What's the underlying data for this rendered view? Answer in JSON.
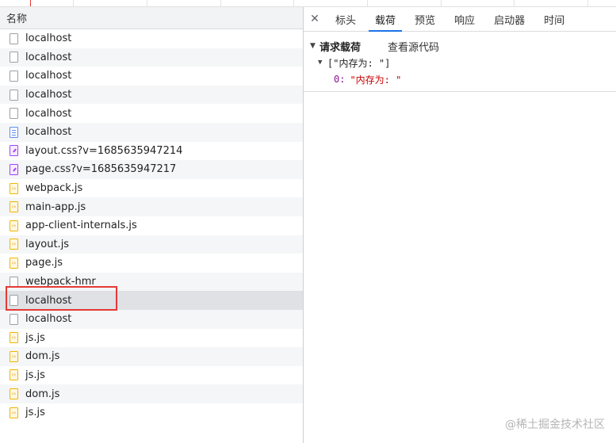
{
  "list": {
    "column_header": "名称",
    "rows": [
      {
        "name": "localhost",
        "icon": "document-icon"
      },
      {
        "name": "localhost",
        "icon": "document-icon"
      },
      {
        "name": "localhost",
        "icon": "document-icon"
      },
      {
        "name": "localhost",
        "icon": "document-icon"
      },
      {
        "name": "localhost",
        "icon": "document-icon"
      },
      {
        "name": "localhost",
        "icon": "html-document-icon"
      },
      {
        "name": "layout.css?v=1685635947214",
        "icon": "stylesheet-icon"
      },
      {
        "name": "page.css?v=1685635947217",
        "icon": "stylesheet-icon"
      },
      {
        "name": "webpack.js",
        "icon": "script-icon"
      },
      {
        "name": "main-app.js",
        "icon": "script-icon"
      },
      {
        "name": "app-client-internals.js",
        "icon": "script-icon"
      },
      {
        "name": "layout.js",
        "icon": "script-icon"
      },
      {
        "name": "page.js",
        "icon": "script-icon"
      },
      {
        "name": "webpack-hmr",
        "icon": "document-icon"
      },
      {
        "name": "localhost",
        "icon": "document-icon",
        "selected": true
      },
      {
        "name": "localhost",
        "icon": "document-icon"
      },
      {
        "name": "js.js",
        "icon": "script-icon"
      },
      {
        "name": "dom.js",
        "icon": "script-icon"
      },
      {
        "name": "js.js",
        "icon": "script-icon"
      },
      {
        "name": "dom.js",
        "icon": "script-icon"
      },
      {
        "name": "js.js",
        "icon": "script-icon"
      }
    ]
  },
  "details": {
    "close_icon": "close-icon",
    "tabs": [
      {
        "label": "标头"
      },
      {
        "label": "载荷",
        "active": true
      },
      {
        "label": "预览"
      },
      {
        "label": "响应"
      },
      {
        "label": "启动器"
      },
      {
        "label": "时间"
      }
    ],
    "payload": {
      "section_title": "请求载荷",
      "view_source": "查看源代码",
      "array_summary": "[\"内存为: \"]",
      "items": [
        {
          "index": "0:",
          "value": "\"内存为: \""
        }
      ]
    }
  },
  "watermark": "@稀土掘金技术社区",
  "colors": {
    "accent": "#1a73e8",
    "highlight": "#e53935",
    "selected_row": "#dfe1e5"
  }
}
